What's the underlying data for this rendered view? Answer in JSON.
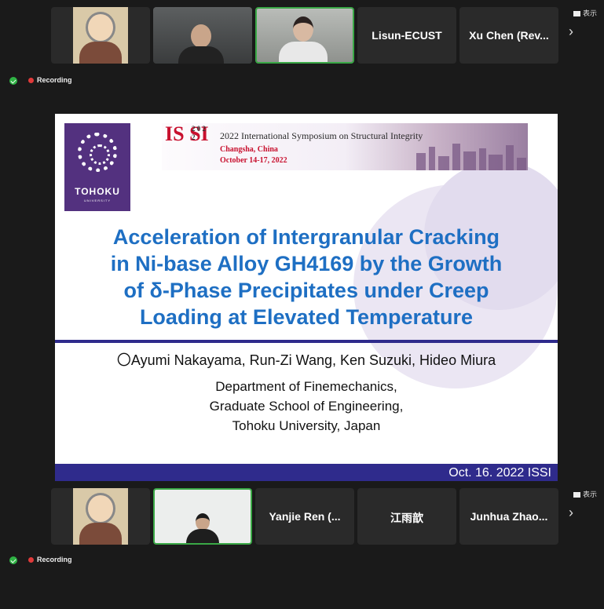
{
  "top_strip": {
    "participants": [
      {
        "name": "",
        "kind": "cartoon"
      },
      {
        "name": "",
        "kind": "camera"
      },
      {
        "name": "",
        "kind": "camera",
        "active": true
      },
      {
        "name": "Lisun-ECUST",
        "kind": "name"
      },
      {
        "name": "Xu Chen (Rev...",
        "kind": "name"
      }
    ],
    "view_label": "表示",
    "next_icon": "chevron-right-icon"
  },
  "recording_top": "Recording",
  "slide": {
    "university": "TOHOKU",
    "university_sub": "UNIVERSITY",
    "logo_letters": "IS SI",
    "year_digits": "2 0 2 2",
    "banner_title": "2022 International Symposium on Structural Integrity",
    "banner_city": "Changsha, China",
    "banner_dates": "October 14-17, 2022",
    "title_lines": [
      "Acceleration of Intergranular Cracking",
      "in Ni-base Alloy GH4169 by the Growth",
      "of δ-Phase Precipitates under Creep",
      "Loading at Elevated Temperature"
    ],
    "authors": "〇Ayumi Nakayama, Run-Zi Wang, Ken Suzuki, Hideo Miura",
    "dept_lines": [
      "Department of Finemechanics,",
      "Graduate School of Engineering,",
      "Tohoku University, Japan"
    ],
    "footer": "Oct. 16. 2022  ISSI"
  },
  "bottom_strip": {
    "participants": [
      {
        "name": "",
        "kind": "cartoon"
      },
      {
        "name": "",
        "kind": "camera",
        "active": true
      },
      {
        "name": "Yanjie Ren  (...",
        "kind": "name"
      },
      {
        "name": "江雨歆",
        "kind": "name"
      },
      {
        "name": "Junhua Zhao...",
        "kind": "name"
      }
    ],
    "view_label": "表示"
  },
  "recording_bottom": "Recording",
  "colors": {
    "accent_green": "#3aa846",
    "recording_red": "#e03a3a",
    "tohoku_purple": "#53317f",
    "title_blue": "#1e6fc3",
    "footer_navy": "#2f2b8c"
  }
}
